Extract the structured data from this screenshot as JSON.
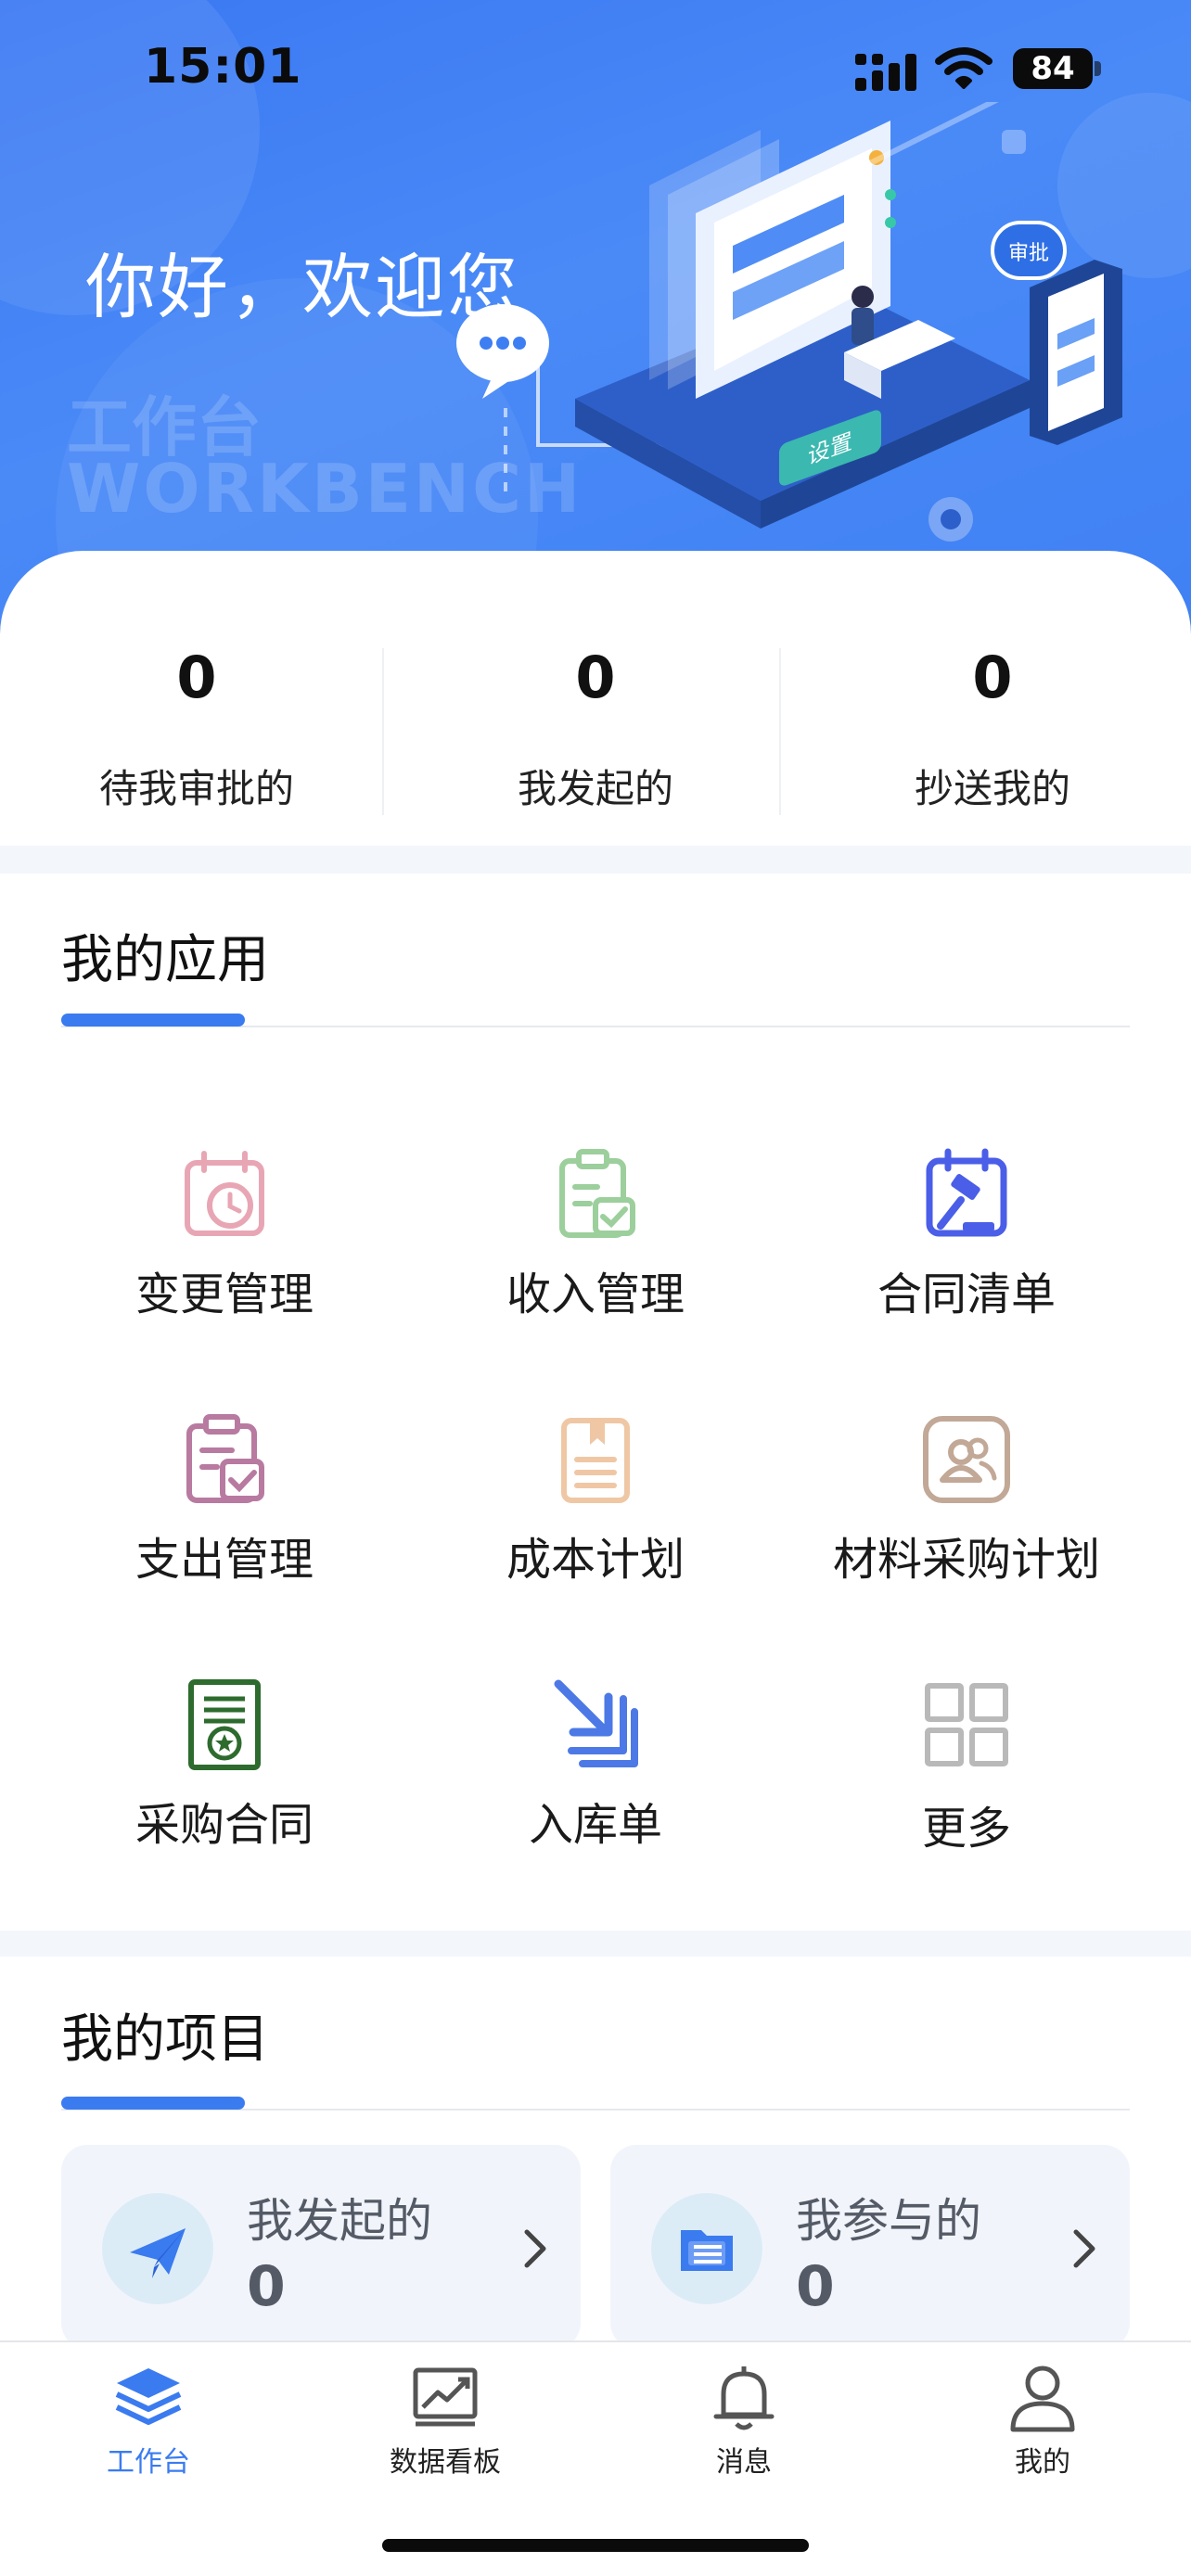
{
  "status_bar": {
    "time": "15:01",
    "battery": "84"
  },
  "hero": {
    "greeting": "你好，欢迎您",
    "watermark_cn": "工作台",
    "watermark_en": "WORKBENCH",
    "illustration_label_approve": "审批",
    "illustration_label_settings": "设置"
  },
  "stats": [
    {
      "value": "0",
      "label": "待我审批的"
    },
    {
      "value": "0",
      "label": "我发起的"
    },
    {
      "value": "0",
      "label": "抄送我的"
    }
  ],
  "apps": {
    "title": "我的应用",
    "items": [
      {
        "label": "变更管理",
        "icon": "alarm-clock-calendar-icon",
        "color": "#e8a6b4"
      },
      {
        "label": "收入管理",
        "icon": "clipboard-check-icon",
        "color": "#9ccf9c"
      },
      {
        "label": "合同清单",
        "icon": "calendar-gavel-icon",
        "color": "#4a5ee8"
      },
      {
        "label": "支出管理",
        "icon": "clipboard-checkbox-icon",
        "color": "#b87aa0"
      },
      {
        "label": "成本计划",
        "icon": "document-bookmark-icon",
        "color": "#efc7a4"
      },
      {
        "label": "材料采购计划",
        "icon": "contacts-card-icon",
        "color": "#c2a896"
      },
      {
        "label": "采购合同",
        "icon": "certificate-star-icon",
        "color": "#2e6b2e"
      },
      {
        "label": "入库单",
        "icon": "arrow-inbox-icon",
        "color": "#4d79e6"
      },
      {
        "label": "更多",
        "icon": "grid-icon",
        "color": "#b9b9b9"
      }
    ]
  },
  "projects": {
    "title": "我的项目",
    "cards": [
      {
        "label": "我发起的",
        "value": "0",
        "icon": "paper-plane-icon"
      },
      {
        "label": "我参与的",
        "value": "0",
        "icon": "folder-list-icon"
      }
    ]
  },
  "tabbar": [
    {
      "label": "工作台",
      "icon": "layers-icon",
      "active": true
    },
    {
      "label": "数据看板",
      "icon": "chart-board-icon",
      "active": false
    },
    {
      "label": "消息",
      "icon": "bell-icon",
      "active": false
    },
    {
      "label": "我的",
      "icon": "person-icon",
      "active": false
    }
  ],
  "colors": {
    "primary": "#3b7bf0",
    "hero_bg": "#4a8af7",
    "card_bg": "#f1f5fb"
  }
}
